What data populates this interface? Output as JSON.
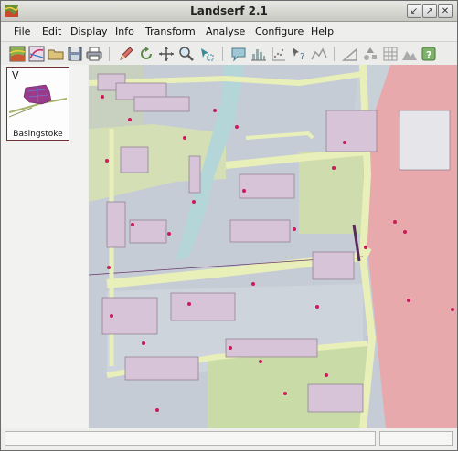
{
  "window": {
    "title": "Landserf 2.1"
  },
  "menu": {
    "file": "File",
    "edit": "Edit",
    "display": "Display",
    "info": "Info",
    "transform": "Transform",
    "analyse": "Analyse",
    "configure": "Configure",
    "help": "Help"
  },
  "thumbnail": {
    "letter": "V",
    "label": "Basingstoke"
  },
  "status": {
    "left": "",
    "right": ""
  },
  "colors": {
    "road": "#e9efb8",
    "building": "#d8c4d8",
    "garden": "#c8d9a8",
    "paved": "#c6ccd6",
    "water": "#b4d6d8",
    "open_land": "#e7a9ab",
    "point": "#cc1a5a"
  }
}
